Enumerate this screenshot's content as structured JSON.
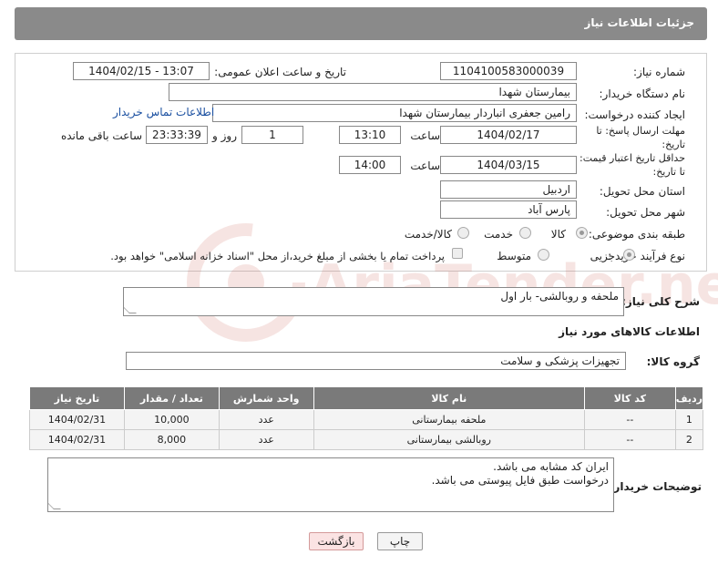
{
  "header": {
    "title": "جزئیات اطلاعات نیاز"
  },
  "form": {
    "need_number": {
      "label": "شماره نیاز:",
      "value": "1104100583000039"
    },
    "announce_datetime": {
      "label": "تاریخ و ساعت اعلان عمومی:",
      "value": "1404/02/15 - 13:07"
    },
    "buyer_org": {
      "label": "نام دستگاه خریدار:",
      "value": "بیمارستان شهدا"
    },
    "requester": {
      "label": "ایجاد کننده درخواست:",
      "value": "رامین جعفری انباردار بیمارستان شهدا",
      "contact_link": "اطلاعات تماس خریدار"
    },
    "reply_deadline": {
      "label_line1": "مهلت ارسال پاسخ: تا",
      "label_line2": "تاریخ:",
      "date": "1404/02/17",
      "time_label": "ساعت",
      "time": "13:10",
      "days": "1",
      "days_label": "روز و",
      "remaining": "23:33:39",
      "remaining_label": "ساعت باقی مانده"
    },
    "price_validity": {
      "label_line1": "حداقل تاریخ اعتبار قیمت:",
      "label_line2": "تا تاریخ:",
      "date": "1404/03/15",
      "time_label": "ساعت",
      "time": "14:00"
    },
    "province": {
      "label": "استان محل تحویل:",
      "value": "اردبیل"
    },
    "city": {
      "label": "شهر محل تحویل:",
      "value": "پارس آباد"
    },
    "category": {
      "label": "طبقه بندی موضوعی:",
      "options": [
        "کالا",
        "خدمت",
        "کالا/خدمت"
      ],
      "selected": "کالا"
    },
    "purchase_process": {
      "label": "نوع فرآیند خرید :",
      "options": [
        "جزیی",
        "متوسط"
      ],
      "selected": "جزیی",
      "treasury_note": "پرداخت تمام یا بخشی از مبلغ خرید،از محل \"اسناد خزانه اسلامی\" خواهد بود."
    }
  },
  "description": {
    "label": "شرح کلی نیاز:",
    "value": "ملحفه و روبالشی- بار اول"
  },
  "items_section": {
    "title": "اطلاعات کالاهای مورد نیاز",
    "group_label": "گروه کالا:",
    "group_value": "تجهیزات پزشکی و سلامت",
    "columns": [
      "ردیف",
      "کد کالا",
      "نام کالا",
      "واحد شمارش",
      "تعداد / مقدار",
      "تاریخ نیاز"
    ],
    "rows": [
      [
        "1",
        "--",
        "ملحفه بیمارستانی",
        "عدد",
        "10,000",
        "1404/02/31"
      ],
      [
        "2",
        "--",
        "روبالشی بیمارستانی",
        "عدد",
        "8,000",
        "1404/02/31"
      ]
    ]
  },
  "buyer_notes": {
    "label": "توضیحات خریدار:",
    "lines": [
      "ایران کد مشابه می باشد.",
      "درخواست طبق فایل پیوستی می باشد."
    ]
  },
  "buttons": {
    "print": "چاپ",
    "back": "بازگشت"
  },
  "watermark": "AriaTender.neT",
  "colors": {
    "header_bg": "#8a8a8a",
    "table_header_bg": "#7a7a7a",
    "link": "#1a4fa0",
    "back_button_bg": "#fbe3e3"
  }
}
